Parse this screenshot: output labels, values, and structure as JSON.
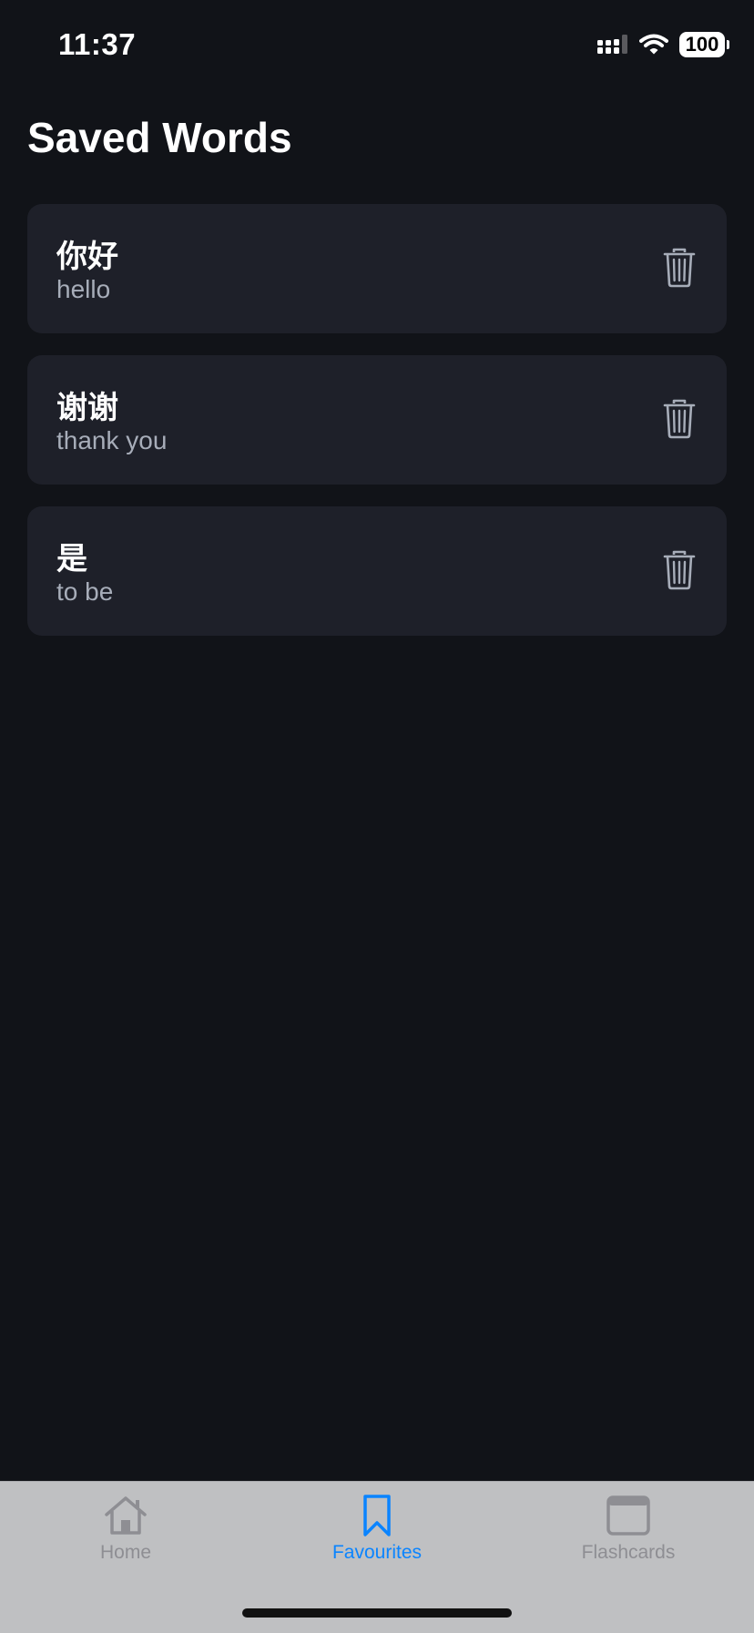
{
  "status_bar": {
    "time": "11:37",
    "battery_level": "100",
    "signal_icon": "cellular-signal-icon",
    "wifi_icon": "wifi-icon"
  },
  "page_title": "Saved Words",
  "words": [
    {
      "chinese": "你好",
      "english": "hello",
      "delete_icon": "trash-icon"
    },
    {
      "chinese": "谢谢",
      "english": "thank you",
      "delete_icon": "trash-icon"
    },
    {
      "chinese": "是",
      "english": "to be",
      "delete_icon": "trash-icon"
    }
  ],
  "tab_bar": {
    "tabs": [
      {
        "label": "Home",
        "icon": "house-icon",
        "active": false
      },
      {
        "label": "Favourites",
        "icon": "bookmark-icon",
        "active": true
      },
      {
        "label": "Flashcards",
        "icon": "card-icon",
        "active": false
      }
    ],
    "active_color": "#0a84ff",
    "inactive_color": "#8e8e93"
  },
  "colors": {
    "background": "#111318",
    "card": "#1e2029",
    "secondary_text": "#a7adb9"
  }
}
